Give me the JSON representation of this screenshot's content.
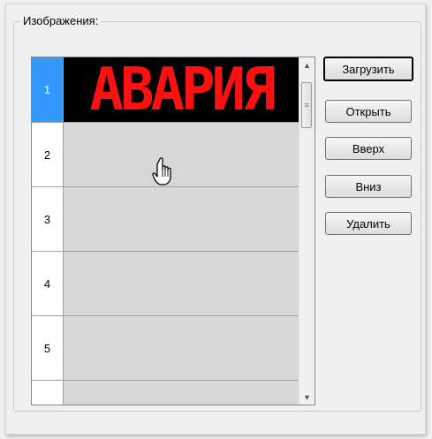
{
  "group": {
    "title": "Изображения:"
  },
  "rows": [
    {
      "index": "1",
      "image_text": "АВАРИЯ"
    },
    {
      "index": "2"
    },
    {
      "index": "3"
    },
    {
      "index": "4"
    },
    {
      "index": "5"
    }
  ],
  "buttons": {
    "load": "Загрузить",
    "open": "Открыть",
    "up": "Вверх",
    "down": "Вниз",
    "delete": "Удалить"
  },
  "colors": {
    "selection": "#3399ff",
    "led_red": "#ff1010",
    "led_background": "#000000"
  },
  "icons": {
    "cursor": "hand-pointer-icon",
    "scroll_up": "arrow-up-icon",
    "scroll_down": "arrow-down-icon"
  }
}
